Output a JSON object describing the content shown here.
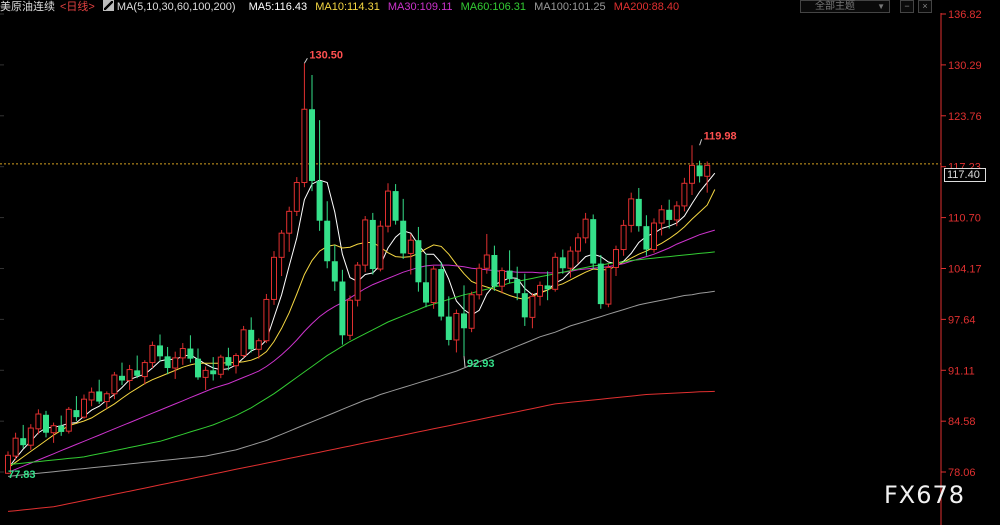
{
  "header": {
    "symbol": "美原油连续",
    "timeframe": "<日线>",
    "ma_params": "MA(5,10,30,60,100,200)",
    "ma": [
      {
        "label": "MA5:116.43",
        "color": "#ffffff"
      },
      {
        "label": "MA10:114.31",
        "color": "#f5d742"
      },
      {
        "label": "MA30:109.11",
        "color": "#cc33cc"
      },
      {
        "label": "MA60:106.31",
        "color": "#33cc33"
      },
      {
        "label": "MA100:101.25",
        "color": "#999999"
      },
      {
        "label": "MA200:88.40",
        "color": "#e03030"
      }
    ],
    "dropdown": "全部主题",
    "min_btn": "−",
    "close_btn": "×"
  },
  "axis": {
    "labels": [
      "136.82",
      "130.29",
      "123.76",
      "117.23",
      "110.70",
      "104.17",
      "97.64",
      "91.11",
      "84.58",
      "78.06"
    ],
    "current_price": "117.40"
  },
  "annotations": {
    "high": "130.50",
    "recent_high": "119.98",
    "low": "92.93",
    "start_low": "77.83"
  },
  "watermark": "FX678",
  "colors": {
    "up": "#e03030",
    "down": "#35e08a",
    "axis": "#e03030",
    "current_line": "#d4a020"
  },
  "chart_data": {
    "type": "candlestick",
    "ylim": [
      77.83,
      136.82
    ],
    "candles": [
      [
        77.9,
        80.7,
        77.8,
        80.2
      ],
      [
        80.1,
        83.1,
        79.6,
        82.4
      ],
      [
        82.4,
        84.1,
        81.1,
        81.5
      ],
      [
        81.5,
        84.2,
        80.9,
        83.7
      ],
      [
        83.6,
        86.1,
        82.9,
        85.5
      ],
      [
        85.4,
        85.9,
        82.5,
        83.1
      ],
      [
        83.1,
        84.4,
        81.8,
        84.0
      ],
      [
        84.0,
        85.3,
        82.7,
        83.2
      ],
      [
        83.3,
        86.4,
        83.0,
        86.1
      ],
      [
        86.0,
        87.8,
        84.6,
        85.1
      ],
      [
        85.1,
        88.0,
        84.9,
        87.4
      ],
      [
        87.3,
        88.9,
        86.5,
        88.3
      ],
      [
        88.4,
        89.9,
        86.8,
        87.1
      ],
      [
        87.1,
        88.4,
        86.2,
        88.1
      ],
      [
        88.1,
        90.9,
        87.4,
        90.5
      ],
      [
        90.4,
        92.1,
        89.2,
        89.8
      ],
      [
        89.8,
        91.8,
        88.6,
        91.2
      ],
      [
        91.1,
        93.0,
        90.1,
        90.4
      ],
      [
        90.3,
        92.4,
        89.3,
        92.1
      ],
      [
        92.1,
        94.8,
        91.4,
        94.3
      ],
      [
        94.3,
        95.7,
        92.2,
        92.9
      ],
      [
        92.9,
        94.1,
        90.6,
        91.4
      ],
      [
        91.4,
        93.5,
        90.0,
        92.7
      ],
      [
        92.7,
        94.6,
        91.8,
        93.9
      ],
      [
        93.9,
        95.6,
        92.1,
        92.6
      ],
      [
        92.6,
        93.9,
        89.9,
        90.2
      ],
      [
        90.2,
        91.6,
        88.6,
        91.1
      ],
      [
        91.1,
        92.8,
        89.8,
        90.6
      ],
      [
        90.6,
        93.1,
        90.1,
        92.8
      ],
      [
        92.8,
        94.0,
        91.1,
        91.7
      ],
      [
        91.7,
        93.3,
        90.7,
        93.0
      ],
      [
        93.0,
        96.8,
        92.7,
        96.3
      ],
      [
        96.3,
        97.9,
        93.4,
        93.8
      ],
      [
        93.8,
        95.2,
        92.6,
        94.9
      ],
      [
        94.9,
        100.9,
        94.6,
        100.2
      ],
      [
        100.2,
        106.4,
        99.5,
        105.6
      ],
      [
        105.6,
        109.1,
        103.2,
        108.7
      ],
      [
        108.7,
        112.1,
        106.3,
        111.5
      ],
      [
        111.5,
        115.9,
        110.9,
        115.2
      ],
      [
        115.2,
        130.5,
        114.6,
        124.6
      ],
      [
        124.6,
        129.0,
        114.1,
        115.4
      ],
      [
        115.4,
        123.2,
        109.0,
        110.3
      ],
      [
        110.3,
        112.8,
        104.2,
        105.1
      ],
      [
        105.1,
        107.2,
        101.3,
        102.5
      ],
      [
        102.5,
        104.0,
        94.4,
        95.6
      ],
      [
        95.6,
        100.7,
        95.0,
        100.1
      ],
      [
        100.1,
        105.0,
        99.3,
        104.6
      ],
      [
        104.6,
        110.9,
        103.7,
        110.4
      ],
      [
        110.4,
        111.3,
        103.4,
        104.1
      ],
      [
        104.1,
        110.3,
        103.8,
        109.6
      ],
      [
        109.6,
        115.1,
        108.8,
        114.1
      ],
      [
        114.1,
        115.0,
        109.8,
        110.3
      ],
      [
        110.3,
        113.1,
        105.4,
        106.1
      ],
      [
        106.1,
        108.6,
        103.4,
        107.8
      ],
      [
        107.8,
        109.5,
        101.2,
        102.4
      ],
      [
        102.4,
        106.1,
        99.2,
        99.8
      ],
      [
        99.8,
        104.5,
        99.0,
        104.1
      ],
      [
        104.1,
        105.0,
        97.5,
        98.0
      ],
      [
        98.0,
        100.6,
        94.3,
        95.0
      ],
      [
        95.0,
        98.9,
        93.4,
        98.4
      ],
      [
        98.4,
        102.0,
        92.9,
        96.5
      ],
      [
        96.5,
        101.2,
        96.0,
        100.8
      ],
      [
        100.8,
        104.8,
        100.2,
        104.2
      ],
      [
        104.2,
        108.6,
        103.5,
        105.9
      ],
      [
        105.9,
        107.1,
        101.3,
        101.9
      ],
      [
        101.9,
        104.3,
        101.0,
        103.9
      ],
      [
        103.9,
        106.5,
        102.3,
        102.8
      ],
      [
        102.8,
        104.4,
        100.1,
        101.0
      ],
      [
        101.0,
        103.5,
        96.8,
        97.9
      ],
      [
        97.9,
        101.0,
        96.5,
        100.6
      ],
      [
        100.6,
        102.5,
        99.4,
        102.0
      ],
      [
        102.0,
        103.8,
        100.1,
        101.5
      ],
      [
        101.5,
        106.2,
        101.2,
        105.6
      ],
      [
        105.6,
        106.6,
        103.5,
        104.2
      ],
      [
        104.2,
        107.0,
        103.0,
        106.4
      ],
      [
        106.4,
        108.7,
        104.8,
        108.1
      ],
      [
        108.1,
        111.3,
        107.4,
        110.5
      ],
      [
        110.5,
        111.1,
        104.1,
        104.8
      ],
      [
        104.8,
        105.9,
        99.0,
        99.6
      ],
      [
        99.6,
        104.7,
        99.2,
        104.3
      ],
      [
        104.3,
        107.1,
        103.2,
        106.6
      ],
      [
        106.6,
        110.4,
        105.8,
        109.7
      ],
      [
        109.7,
        113.9,
        108.8,
        113.1
      ],
      [
        113.1,
        114.5,
        108.9,
        109.6
      ],
      [
        109.6,
        111.0,
        105.8,
        106.6
      ],
      [
        106.6,
        110.6,
        106.2,
        110.0
      ],
      [
        110.0,
        112.3,
        108.4,
        111.7
      ],
      [
        111.7,
        113.0,
        109.3,
        110.4
      ],
      [
        110.4,
        112.8,
        109.6,
        112.2
      ],
      [
        112.2,
        115.8,
        111.5,
        115.1
      ],
      [
        115.1,
        119.98,
        113.6,
        117.4
      ],
      [
        117.4,
        118.0,
        115.2,
        116.0
      ],
      [
        116.0,
        117.9,
        113.9,
        117.4
      ]
    ],
    "moving_averages": {
      "MA5": [
        78.5,
        79.8,
        81.0,
        82.0,
        83.1,
        83.7,
        83.8,
        84.0,
        84.3,
        84.4,
        85.2,
        86.0,
        86.5,
        87.3,
        88.0,
        88.9,
        89.9,
        90.3,
        90.6,
        91.4,
        92.3,
        92.5,
        92.5,
        92.9,
        93.1,
        92.5,
        91.9,
        91.4,
        91.2,
        91.3,
        91.8,
        92.7,
        93.6,
        94.0,
        95.0,
        97.9,
        100.8,
        104.5,
        108.1,
        113.0,
        115.0,
        115.5,
        115.2,
        111.4,
        106.0,
        103.0,
        102.5,
        103.4,
        103.6,
        104.6,
        106.8,
        108.2,
        109.0,
        108.7,
        107.2,
        106.0,
        106.0,
        104.9,
        102.8,
        100.0,
        98.9,
        98.2,
        98.8,
        100.9,
        102.1,
        102.5,
        103.0,
        102.9,
        101.6,
        100.8,
        101.1,
        101.4,
        102.3,
        102.8,
        103.8,
        104.7,
        105.7,
        106.0,
        105.7,
        105.0,
        104.8,
        105.1,
        106.1,
        107.5,
        108.3,
        108.7,
        109.3,
        109.6,
        110.0,
        110.9,
        112.5,
        114.0,
        115.2,
        116.4
      ],
      "MA10": [
        78.6,
        79.3,
        80.0,
        80.7,
        81.4,
        82.1,
        82.8,
        83.4,
        84.0,
        84.3,
        84.6,
        85.0,
        85.6,
        86.2,
        86.8,
        87.5,
        88.2,
        88.8,
        89.4,
        89.9,
        90.3,
        90.7,
        91.1,
        91.5,
        91.8,
        92.0,
        92.0,
        92.0,
        92.0,
        92.1,
        92.1,
        92.2,
        92.4,
        92.8,
        93.5,
        94.8,
        96.5,
        98.5,
        100.9,
        103.4,
        105.2,
        106.4,
        107.0,
        107.2,
        106.8,
        106.9,
        107.3,
        107.5,
        107.5,
        106.9,
        106.2,
        105.7,
        105.6,
        105.7,
        106.1,
        106.7,
        107.2,
        107.0,
        106.0,
        104.7,
        103.5,
        102.5,
        102.1,
        101.8,
        101.5,
        101.1,
        100.7,
        100.4,
        100.2,
        100.6,
        101.0,
        101.4,
        101.9,
        102.2,
        102.7,
        103.2,
        103.7,
        104.1,
        104.0,
        104.0,
        104.5,
        105.0,
        105.5,
        106.0,
        106.4,
        106.9,
        107.4,
        108.0,
        108.7,
        109.5,
        110.5,
        111.4,
        112.3,
        114.3
      ],
      "MA30": [
        78.0,
        78.4,
        78.8,
        79.2,
        79.6,
        80.0,
        80.4,
        80.8,
        81.2,
        81.6,
        82.0,
        82.4,
        82.8,
        83.2,
        83.6,
        84.0,
        84.4,
        84.8,
        85.2,
        85.6,
        86.0,
        86.4,
        86.8,
        87.2,
        87.6,
        88.0,
        88.4,
        88.8,
        89.1,
        89.4,
        89.8,
        90.2,
        90.6,
        91.0,
        91.6,
        92.3,
        93.1,
        94.0,
        95.0,
        96.1,
        97.1,
        98.0,
        98.7,
        99.3,
        99.8,
        100.4,
        101.0,
        101.6,
        102.1,
        102.5,
        102.9,
        103.3,
        103.7,
        104.0,
        104.3,
        104.5,
        104.6,
        104.6,
        104.6,
        104.5,
        104.4,
        104.2,
        104.1,
        104.0,
        103.9,
        103.8,
        103.8,
        103.7,
        103.7,
        103.7,
        103.6,
        103.6,
        103.6,
        103.7,
        103.8,
        104.0,
        104.1,
        104.2,
        104.3,
        104.4,
        104.6,
        104.8,
        105.1,
        105.4,
        105.7,
        106.0,
        106.4,
        106.8,
        107.3,
        107.7,
        108.1,
        108.5,
        108.8,
        109.1
      ],
      "MA60": [
        79.0,
        79.1,
        79.2,
        79.3,
        79.4,
        79.5,
        79.6,
        79.7,
        79.8,
        79.9,
        80.0,
        80.2,
        80.4,
        80.6,
        80.8,
        81.0,
        81.2,
        81.4,
        81.6,
        81.8,
        82.0,
        82.3,
        82.6,
        82.9,
        83.2,
        83.5,
        83.8,
        84.1,
        84.5,
        84.9,
        85.3,
        85.8,
        86.3,
        86.9,
        87.5,
        88.1,
        88.8,
        89.5,
        90.2,
        90.9,
        91.6,
        92.3,
        93.0,
        93.6,
        94.2,
        94.8,
        95.3,
        95.8,
        96.3,
        96.8,
        97.3,
        97.7,
        98.1,
        98.5,
        98.9,
        99.3,
        99.6,
        99.9,
        100.2,
        100.5,
        100.8,
        101.0,
        101.3,
        101.5,
        101.8,
        102.0,
        102.3,
        102.5,
        102.7,
        102.9,
        103.1,
        103.3,
        103.5,
        103.7,
        103.9,
        104.1,
        104.3,
        104.5,
        104.6,
        104.8,
        104.9,
        105.0,
        105.2,
        105.3,
        105.4,
        105.5,
        105.6,
        105.7,
        105.8,
        105.9,
        106.0,
        106.1,
        106.2,
        106.3
      ],
      "MA100": [
        77.5,
        77.6,
        77.7,
        77.8,
        77.9,
        78.0,
        78.1,
        78.2,
        78.3,
        78.4,
        78.5,
        78.6,
        78.7,
        78.8,
        78.9,
        79.0,
        79.1,
        79.2,
        79.3,
        79.4,
        79.5,
        79.6,
        79.7,
        79.8,
        79.9,
        80.0,
        80.1,
        80.3,
        80.5,
        80.7,
        80.9,
        81.2,
        81.5,
        81.8,
        82.1,
        82.5,
        82.9,
        83.3,
        83.7,
        84.1,
        84.5,
        84.9,
        85.3,
        85.7,
        86.1,
        86.5,
        86.9,
        87.3,
        87.6,
        88.0,
        88.3,
        88.6,
        88.9,
        89.2,
        89.5,
        89.8,
        90.1,
        90.4,
        90.7,
        91.0,
        91.4,
        91.8,
        92.2,
        92.6,
        93.0,
        93.4,
        93.8,
        94.2,
        94.6,
        95.0,
        95.4,
        95.7,
        96.0,
        96.4,
        96.8,
        97.1,
        97.4,
        97.7,
        98.0,
        98.3,
        98.6,
        98.9,
        99.2,
        99.5,
        99.7,
        99.9,
        100.1,
        100.3,
        100.5,
        100.7,
        100.8,
        101.0,
        101.1,
        101.25
      ],
      "MA200": [
        73.0,
        73.1,
        73.2,
        73.3,
        73.4,
        73.5,
        73.6,
        73.8,
        74.0,
        74.2,
        74.4,
        74.6,
        74.8,
        75.0,
        75.2,
        75.4,
        75.6,
        75.8,
        76.0,
        76.2,
        76.4,
        76.6,
        76.8,
        77.0,
        77.2,
        77.4,
        77.6,
        77.8,
        78.0,
        78.2,
        78.4,
        78.6,
        78.8,
        79.0,
        79.2,
        79.4,
        79.6,
        79.8,
        80.0,
        80.2,
        80.4,
        80.6,
        80.8,
        81.0,
        81.2,
        81.4,
        81.6,
        81.8,
        82.0,
        82.2,
        82.4,
        82.6,
        82.8,
        83.0,
        83.2,
        83.4,
        83.6,
        83.8,
        84.0,
        84.2,
        84.4,
        84.6,
        84.8,
        85.0,
        85.2,
        85.4,
        85.6,
        85.8,
        86.0,
        86.2,
        86.4,
        86.6,
        86.8,
        86.9,
        87.0,
        87.1,
        87.2,
        87.3,
        87.4,
        87.5,
        87.6,
        87.7,
        87.8,
        87.9,
        88.0,
        88.05,
        88.1,
        88.15,
        88.2,
        88.25,
        88.3,
        88.35,
        88.38,
        88.4
      ]
    }
  }
}
